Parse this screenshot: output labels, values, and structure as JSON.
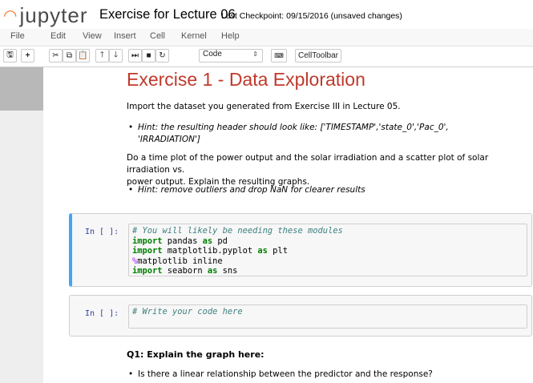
{
  "header": {
    "logo_text": "jupyter",
    "notebook_title": "Exercise for Lecture 06",
    "checkpoint": "Last Checkpoint: 09/15/2016 (unsaved changes)"
  },
  "menu": [
    "File",
    "Edit",
    "View",
    "Insert",
    "Cell",
    "Kernel",
    "Help"
  ],
  "toolbar": {
    "icons": [
      "save-icon",
      "plus-icon",
      "cut-icon",
      "copy-icon",
      "paste-icon",
      "arrow-up-icon",
      "arrow-down-icon",
      "step-forward-icon",
      "stop-icon",
      "restart-icon",
      "keyboard-icon"
    ],
    "cell_type": "Code",
    "celltoolbar_label": "CellToolbar"
  },
  "markdown": {
    "heading": "Exercise 1 - Data Exploration",
    "para1": "Import the dataset you generated from Exercise III in Lecture 05.",
    "hint1_line1": "Hint: the resulting header should look like: ['TIMESTAMP','state_0','Pac_0',",
    "hint1_line2": "'IRRADIATION']",
    "para2_line1": "Do a time plot of the power output and the solar irradiation and a scatter plot of solar irradiation vs.",
    "para2_line2": "power output. Explain the resulting graphs.",
    "hint2": "Hint: remove outliers and drop NaN for clearer results"
  },
  "cells": [
    {
      "prompt": "In [ ]:",
      "line1_comment": "# You will likely be needing these modules",
      "line2": [
        "import",
        " pandas ",
        "as",
        " pd"
      ],
      "line3": [
        "import",
        " matplotlib.pyplot ",
        "as",
        " plt"
      ],
      "line4": [
        "%",
        "matplotlib inline"
      ],
      "line5": [
        "import",
        " seaborn ",
        "as",
        " sns"
      ]
    },
    {
      "prompt": "In [ ]:",
      "comment": "# Write your code here"
    }
  ],
  "q1": {
    "title": "Q1: Explain the graph here:",
    "bullet": "Is there a linear relationship between the predictor and the response?"
  }
}
